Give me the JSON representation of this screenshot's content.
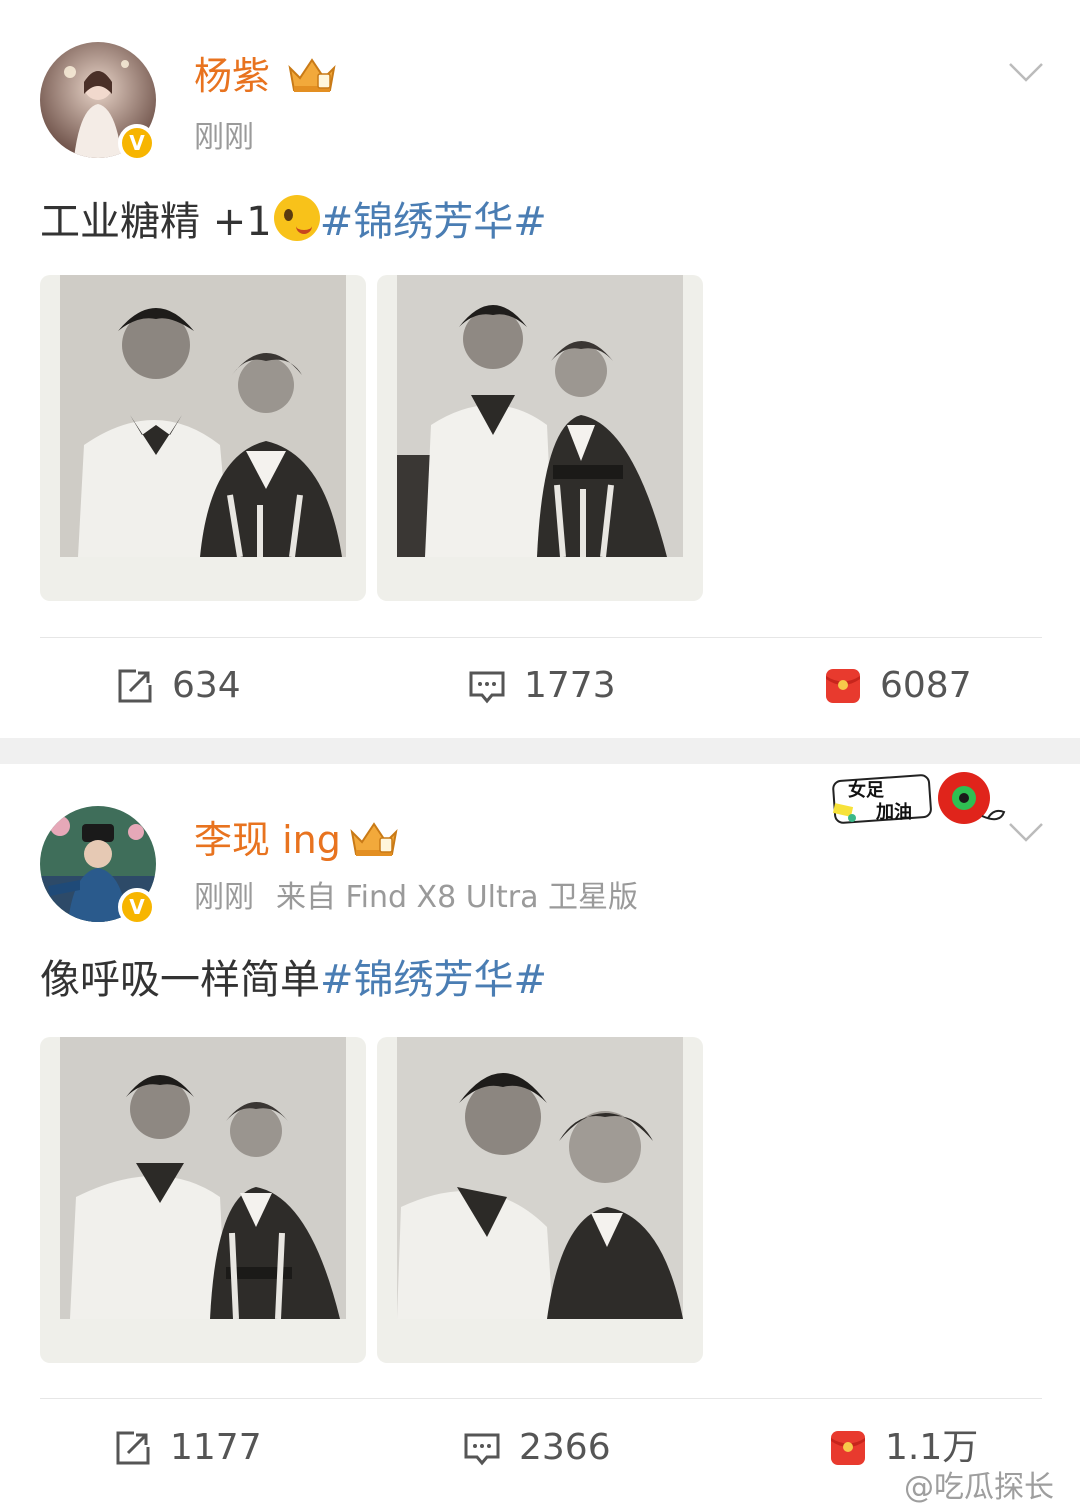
{
  "posts": [
    {
      "author": "杨紫",
      "time": "刚刚",
      "source": "",
      "text": "工业糖精 +1",
      "emoji": "wink-tongue-emoji",
      "topic": "#锦绣芳华#",
      "photos": [
        "photo-1",
        "photo-2"
      ],
      "reposts": "634",
      "comments": "1773",
      "likes": "6087"
    },
    {
      "author": "李现 ing",
      "time": "刚刚",
      "source": "来自 Find X8 Ultra 卫星版",
      "text": "像呼吸一样简单",
      "topic": "#锦绣芳华#",
      "photos": [
        "photo-1",
        "photo-2"
      ],
      "reposts": "1177",
      "comments": "2366",
      "likes": "1.1万"
    }
  ],
  "sticker": {
    "line1": "女足",
    "line2": "加油"
  },
  "watermark": "@吃瓜探长",
  "colors": {
    "name": "#e8731f",
    "topic": "#4a7db3",
    "badge": "#f7b500",
    "like": "#e83a2e"
  },
  "icons": [
    "repost-icon",
    "comment-icon",
    "like-icon",
    "crown-icon",
    "verified-icon",
    "chevron-down-icon"
  ]
}
